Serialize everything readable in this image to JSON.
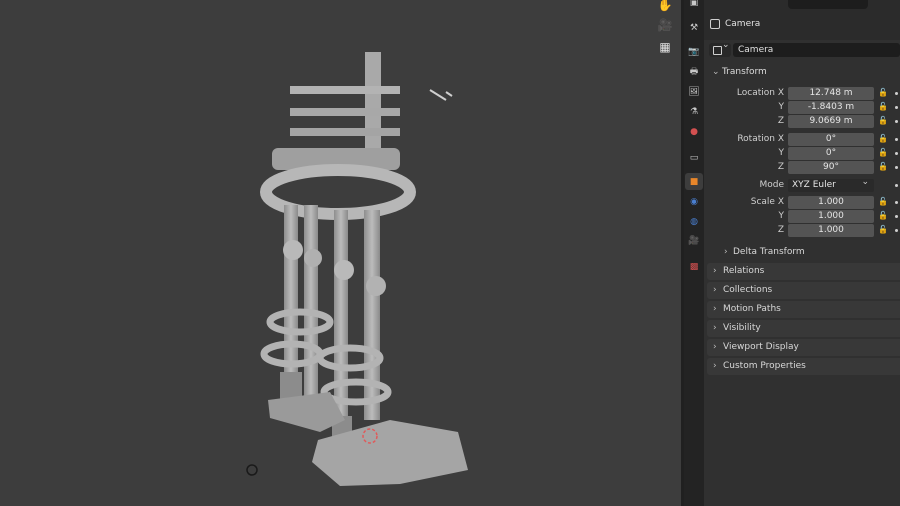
{
  "header": {
    "context_title": "Camera",
    "object_name": "Camera"
  },
  "transform": {
    "title": "Transform",
    "location": {
      "label_x": "Location X",
      "label_y": "Y",
      "label_z": "Z",
      "x": "12.748 m",
      "y": "-1.8403 m",
      "z": "9.0669 m"
    },
    "rotation": {
      "label_x": "Rotation X",
      "label_y": "Y",
      "label_z": "Z",
      "x": "0°",
      "y": "0°",
      "z": "90°"
    },
    "mode": {
      "label": "Mode",
      "value": "XYZ Euler"
    },
    "scale": {
      "label_x": "Scale X",
      "label_y": "Y",
      "label_z": "Z",
      "x": "1.000",
      "y": "1.000",
      "z": "1.000"
    },
    "delta_label": "Delta Transform"
  },
  "sections": [
    "Relations",
    "Collections",
    "Motion Paths",
    "Visibility",
    "Viewport Display",
    "Custom Properties"
  ],
  "icons": {
    "viewport_nav": [
      "hand-icon",
      "camera-view-icon",
      "grid-icon"
    ],
    "tabs": [
      "tool-icon",
      "render-icon",
      "output-icon",
      "view-layer-icon",
      "scene-icon",
      "world-icon",
      "collection-icon",
      "object-icon",
      "modifier-icon",
      "physics-icon",
      "constraint-icon",
      "data-icon",
      "texture-icon"
    ]
  },
  "colors": {
    "viewport_bg": "#3d3d3d",
    "panel_bg": "#303030",
    "field_bg": "#545454",
    "object_tab_accent": "#e8862a"
  }
}
